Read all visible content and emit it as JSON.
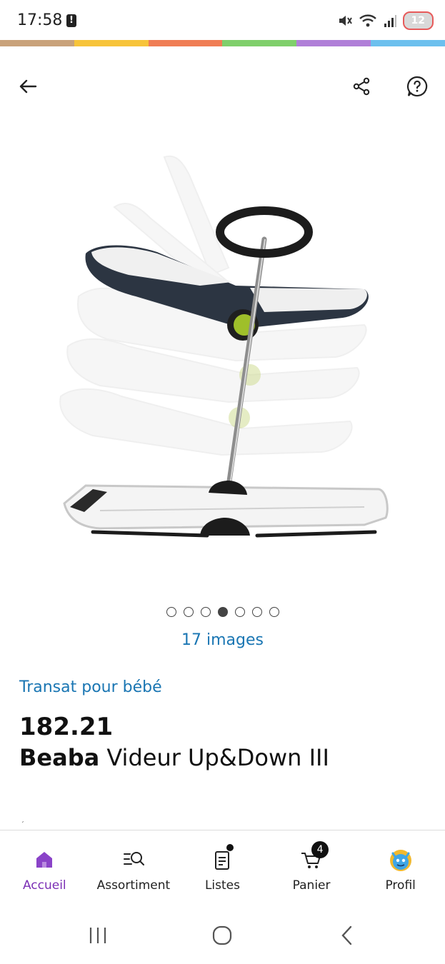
{
  "status_bar": {
    "time": "17:58",
    "alert_glyph": "!",
    "battery": "12"
  },
  "brand_colors": [
    "#c9a27a",
    "#f7c43a",
    "#f07d55",
    "#7fcf6b",
    "#b07fd8",
    "#6cc0ee"
  ],
  "header": {
    "back_icon": "arrow-left-icon",
    "share_icon": "share-icon",
    "help_icon": "question-circle-icon"
  },
  "gallery": {
    "dot_count": 7,
    "active_index": 3,
    "image_count_label": "17 images"
  },
  "product": {
    "category": "Transat pour bébé",
    "price": "182.21",
    "brand": "Beaba",
    "name": "Videur Up&Down III"
  },
  "bottom_nav": {
    "items": [
      {
        "label": "Accueil",
        "icon": "home-icon",
        "active": true
      },
      {
        "label": "Assortiment",
        "icon": "search-list-icon",
        "active": false
      },
      {
        "label": "Listes",
        "icon": "list-icon",
        "active": false
      },
      {
        "label": "Panier",
        "icon": "cart-icon",
        "active": false,
        "badge": "4"
      },
      {
        "label": "Profil",
        "icon": "avatar-icon",
        "active": false
      }
    ]
  },
  "accent_color": "#7b2fb5",
  "link_color": "#1a76b3"
}
